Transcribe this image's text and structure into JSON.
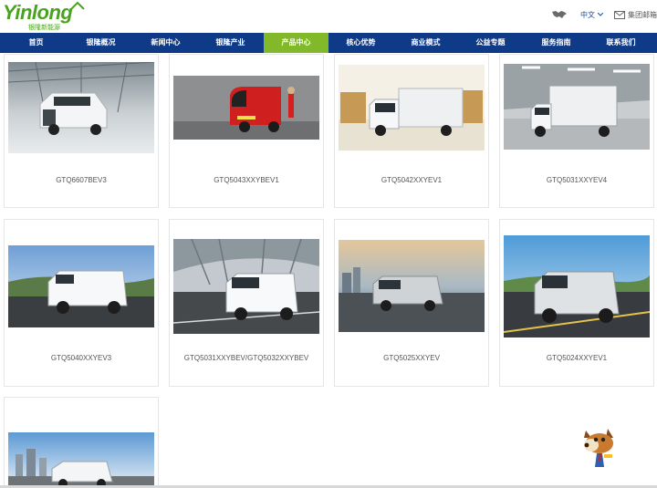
{
  "header": {
    "logo_text": "Yinlong",
    "logo_sub": "银隆新能源",
    "language": "中文",
    "group_mail": "集团邮箱"
  },
  "nav": {
    "items": [
      "首页",
      "银隆概况",
      "新闻中心",
      "银隆产业",
      "产品中心",
      "核心优势",
      "商业模式",
      "公益专题",
      "服务指南",
      "联系我们"
    ],
    "active": "产品中心"
  },
  "products": [
    "GTQ6607BEV3",
    "GTQ5043XXYBEV1",
    "GTQ5042XXYEV1",
    "GTQ5031XXYEV4",
    "GTQ5040XXYEV3",
    "GTQ5031XXYBEV/GTQ5032XXYBEV",
    "GTQ5025XXYEV",
    "GTQ5024XXYEV1",
    ""
  ],
  "colors": {
    "nav_bg": "#0e3a87",
    "nav_active": "#82b92a",
    "brand_green": "#4aa31e"
  }
}
